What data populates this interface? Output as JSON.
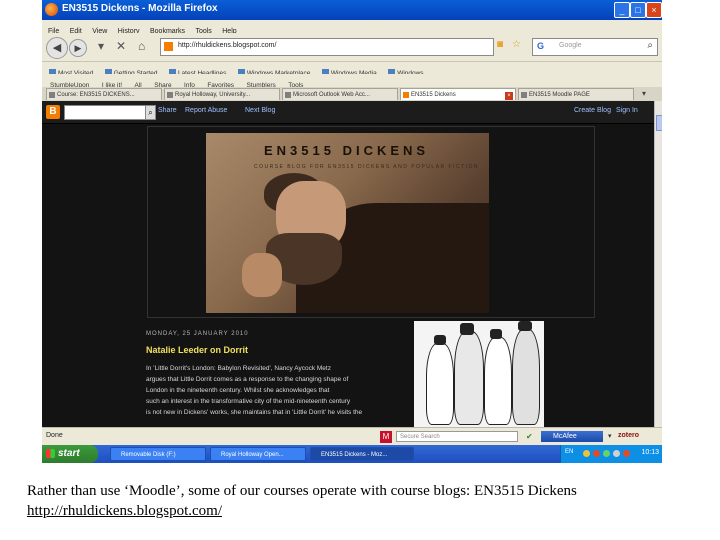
{
  "window": {
    "title": "EN3515 Dickens - Mozilla Firefox"
  },
  "menu": [
    "File",
    "Edit",
    "View",
    "History",
    "Bookmarks",
    "Tools",
    "Help"
  ],
  "nav": {
    "url": "http://rhuldickens.blogspot.com/",
    "search_placeholder": "Google",
    "search_logo": "G"
  },
  "bookmarks": [
    "Most Visited",
    "Getting Started",
    "Latest Headlines",
    "Windows Marketplace",
    "Windows Media",
    "Windows"
  ],
  "stumble": [
    "StumbleUpon",
    "I like it!",
    "All",
    "Share",
    "Info",
    "Favorites",
    "Stumblers",
    "Tools"
  ],
  "tabs": [
    {
      "label": "Course: EN3515 DICKENS...",
      "active": false
    },
    {
      "label": "Royal Holloway, University...",
      "active": false
    },
    {
      "label": "Microsoft Outlook Web Acc...",
      "active": false
    },
    {
      "label": "EN3515 Dickens",
      "active": true
    },
    {
      "label": "EN3515 Moodle PAGE",
      "active": false
    }
  ],
  "blogger_nav": {
    "logo": "B",
    "links": [
      "Share",
      "Report Abuse",
      "Next Blog"
    ],
    "right_links": [
      "Create Blog",
      "Sign In"
    ]
  },
  "blog": {
    "title": "EN3515 DICKENS",
    "description": "COURSE BLOG FOR EN3515 DICKENS AND POPULAR FICTION",
    "date": "MONDAY, 25 JANUARY 2010",
    "post_title": "Natalie Leeder on Dorrit",
    "post_lines": [
      "In 'Little Dorrit's London: Babylon Revisited', Nancy Aycock Metz",
      "argues that Little Dorrit comes as a response to the changing shape of",
      "London in the nineteenth century. Whilst she acknowledges that",
      "such an interest in the transformative city of the mid-nineteenth century",
      "is not new in Dickens' works, she maintains that in 'Little Dorrit' he visits the"
    ]
  },
  "status": {
    "done": "Done",
    "secure_search": "Secure Search",
    "mcafee": "McAfee",
    "zotero": "zotero"
  },
  "taskbar": {
    "start": "start",
    "items": [
      "Removable Disk (F:)",
      "Royal Holloway Open...",
      "EN3515 Dickens - Moz..."
    ],
    "lang": "EN",
    "clock": "10:13"
  },
  "caption": {
    "text": "Rather than use ‘Moodle’, some of our courses operate with course blogs: EN3515 Dickens",
    "link": "http://rhuldickens.blogspot.com/"
  }
}
